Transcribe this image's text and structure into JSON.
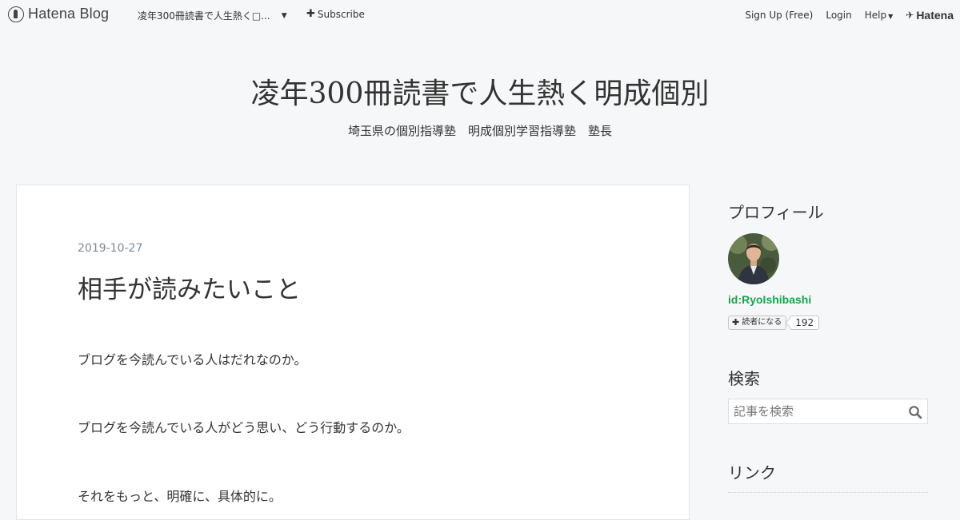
{
  "topbar": {
    "logo_text": "Hatena Blog",
    "blog_select_label": "凌󠄀年300冊読書で人生熱く□...",
    "subscribe_label": "Subscribe",
    "signup_label": "Sign Up (Free)",
    "login_label": "Login",
    "help_label": "Help",
    "hatena_label": "Hatena"
  },
  "header": {
    "title": "凌󠄀年300冊読書で人生熱く󠄀明成個別",
    "description": "埼玉県の個別指導塾　明成個別学習指導塾　塾長"
  },
  "entry": {
    "date": "2019-10-27",
    "title": "相手が読みたいこと",
    "paragraphs": [
      "ブログを今読んでいる人はだれなのか。",
      "ブログを今読んでいる人がどう思い、どう行動するのか。",
      "それをもっと、明確に、具体的に。"
    ]
  },
  "sidebar": {
    "profile_title": "プロフィール",
    "user_id": "id:RyoIshibashi",
    "reader_button_label": "読者になる",
    "reader_count": "192",
    "search_title": "検索",
    "search_placeholder": "記事を検索",
    "link_title": "リンク"
  },
  "icons": {
    "logo": "hatena-blog-logo-icon",
    "subscribe": "plus-icon",
    "search": "search-icon",
    "caret": "caret-down-icon"
  }
}
